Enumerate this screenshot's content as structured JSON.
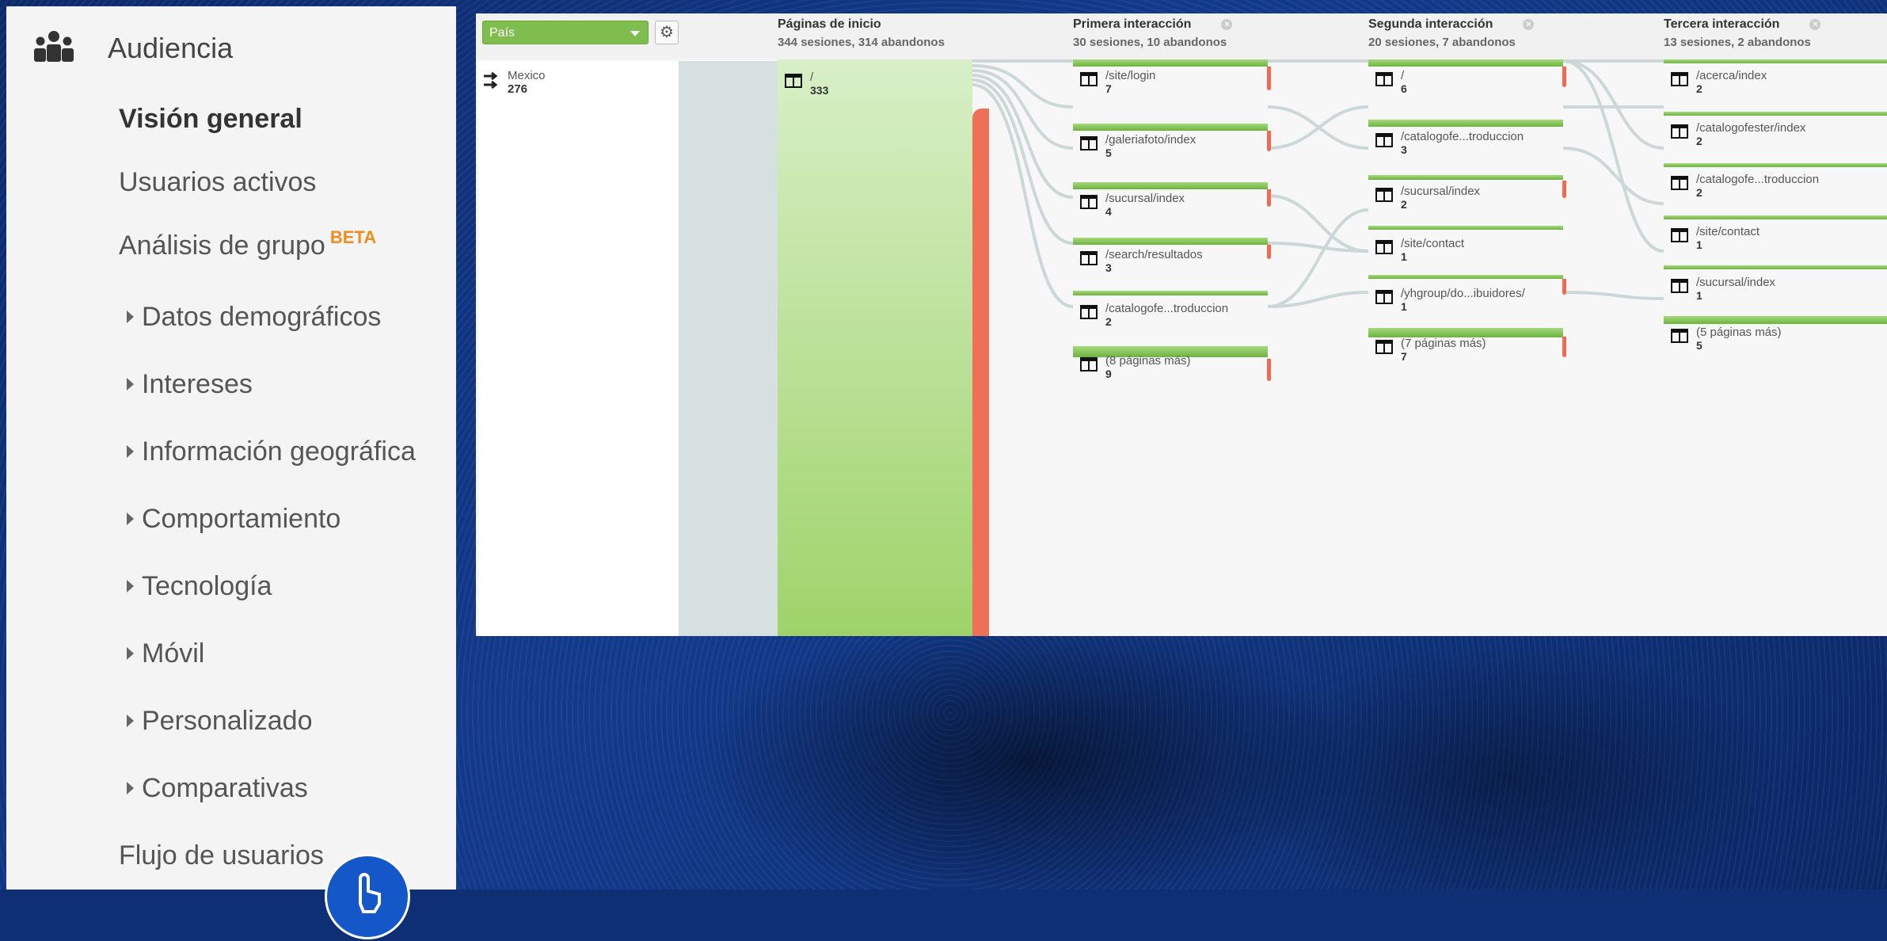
{
  "sidebar": {
    "title": "Audiencia",
    "items": [
      {
        "label": "Visión general",
        "active": true,
        "expandable": false
      },
      {
        "label": "Usuarios activos",
        "active": false,
        "expandable": false
      },
      {
        "label": "Análisis de grupo",
        "badge": "BETA",
        "active": false,
        "expandable": false
      },
      {
        "label": "Datos demográficos",
        "expandable": true
      },
      {
        "label": "Intereses",
        "expandable": true
      },
      {
        "label": "Información geográfica",
        "expandable": true
      },
      {
        "label": "Comportamiento",
        "expandable": true
      },
      {
        "label": "Tecnología",
        "expandable": true
      },
      {
        "label": "Móvil",
        "expandable": true
      },
      {
        "label": "Personalizado",
        "expandable": true
      },
      {
        "label": "Comparativas",
        "expandable": true
      },
      {
        "label": "Flujo de usuarios",
        "expandable": false
      }
    ]
  },
  "flow": {
    "dimension_select": "País",
    "dimension_node": {
      "label": "Mexico",
      "count": "276"
    },
    "columns": [
      {
        "title": "Páginas de inicio",
        "subtitle": "344 sesiones, 314 abandonos"
      },
      {
        "title": "Primera interacción",
        "subtitle": "30 sesiones, 10 abandonos"
      },
      {
        "title": "Segunda interacción",
        "subtitle": "20 sesiones, 7 abandonos"
      },
      {
        "title": "Tercera interacción",
        "subtitle": "13 sesiones, 2 abandonos"
      }
    ],
    "start_node": {
      "label": "/",
      "count": "333"
    },
    "first": [
      {
        "label": "/site/login",
        "count": "7"
      },
      {
        "label": "/galeriafoto/index",
        "count": "5"
      },
      {
        "label": "/sucursal/index",
        "count": "4"
      },
      {
        "label": "/search/resultados",
        "count": "3"
      },
      {
        "label": "/catalogofe...troduccion",
        "count": "2"
      },
      {
        "label": "(8 páginas más)",
        "count": "9"
      }
    ],
    "second": [
      {
        "label": "/",
        "count": "6"
      },
      {
        "label": "/catalogofe...troduccion",
        "count": "3"
      },
      {
        "label": "/sucursal/index",
        "count": "2"
      },
      {
        "label": "/site/contact",
        "count": "1"
      },
      {
        "label": "/yhgroup/do...ibuidores/",
        "count": "1"
      },
      {
        "label": "(7 páginas más)",
        "count": "7"
      }
    ],
    "third": [
      {
        "label": "/acerca/index",
        "count": "2"
      },
      {
        "label": "/catalogofester/index",
        "count": "2"
      },
      {
        "label": "/catalogofe...troduccion",
        "count": "2"
      },
      {
        "label": "/site/contact",
        "count": "1"
      },
      {
        "label": "/sucursal/index",
        "count": "1"
      },
      {
        "label": "(5 páginas más)",
        "count": "5"
      }
    ]
  },
  "colors": {
    "accent_green": "#7fbd4e",
    "drop_red": "#f07057",
    "beta_orange": "#f08c1e"
  }
}
